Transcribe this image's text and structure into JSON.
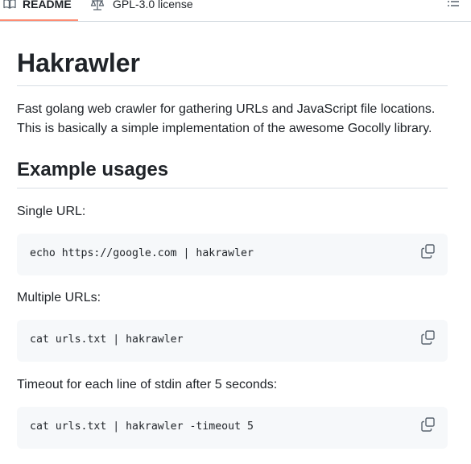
{
  "tabs": {
    "readme_label": "README",
    "license_label": "GPL-3.0 license"
  },
  "readme": {
    "title": "Hakrawler",
    "intro": "Fast golang web crawler for gathering URLs and JavaScript file locations. This is basically a simple implementation of the awesome Gocolly library.",
    "section_title": "Example usages",
    "examples": [
      {
        "label": "Single URL:",
        "code": "echo https://google.com | hakrawler"
      },
      {
        "label": "Multiple URLs:",
        "code": "cat urls.txt | hakrawler"
      },
      {
        "label": "Timeout for each line of stdin after 5 seconds:",
        "code": "cat urls.txt | hakrawler -timeout 5"
      }
    ]
  },
  "icons": {
    "readme_tab": "book-icon",
    "license_tab": "scale-icon",
    "outline": "list-icon",
    "copy": "copy-icon"
  },
  "colors": {
    "active_tab_underline": "#fd8c73",
    "code_background": "#f6f8fa",
    "border": "#d0d7de",
    "text": "#1f2328",
    "muted": "#59636e"
  }
}
